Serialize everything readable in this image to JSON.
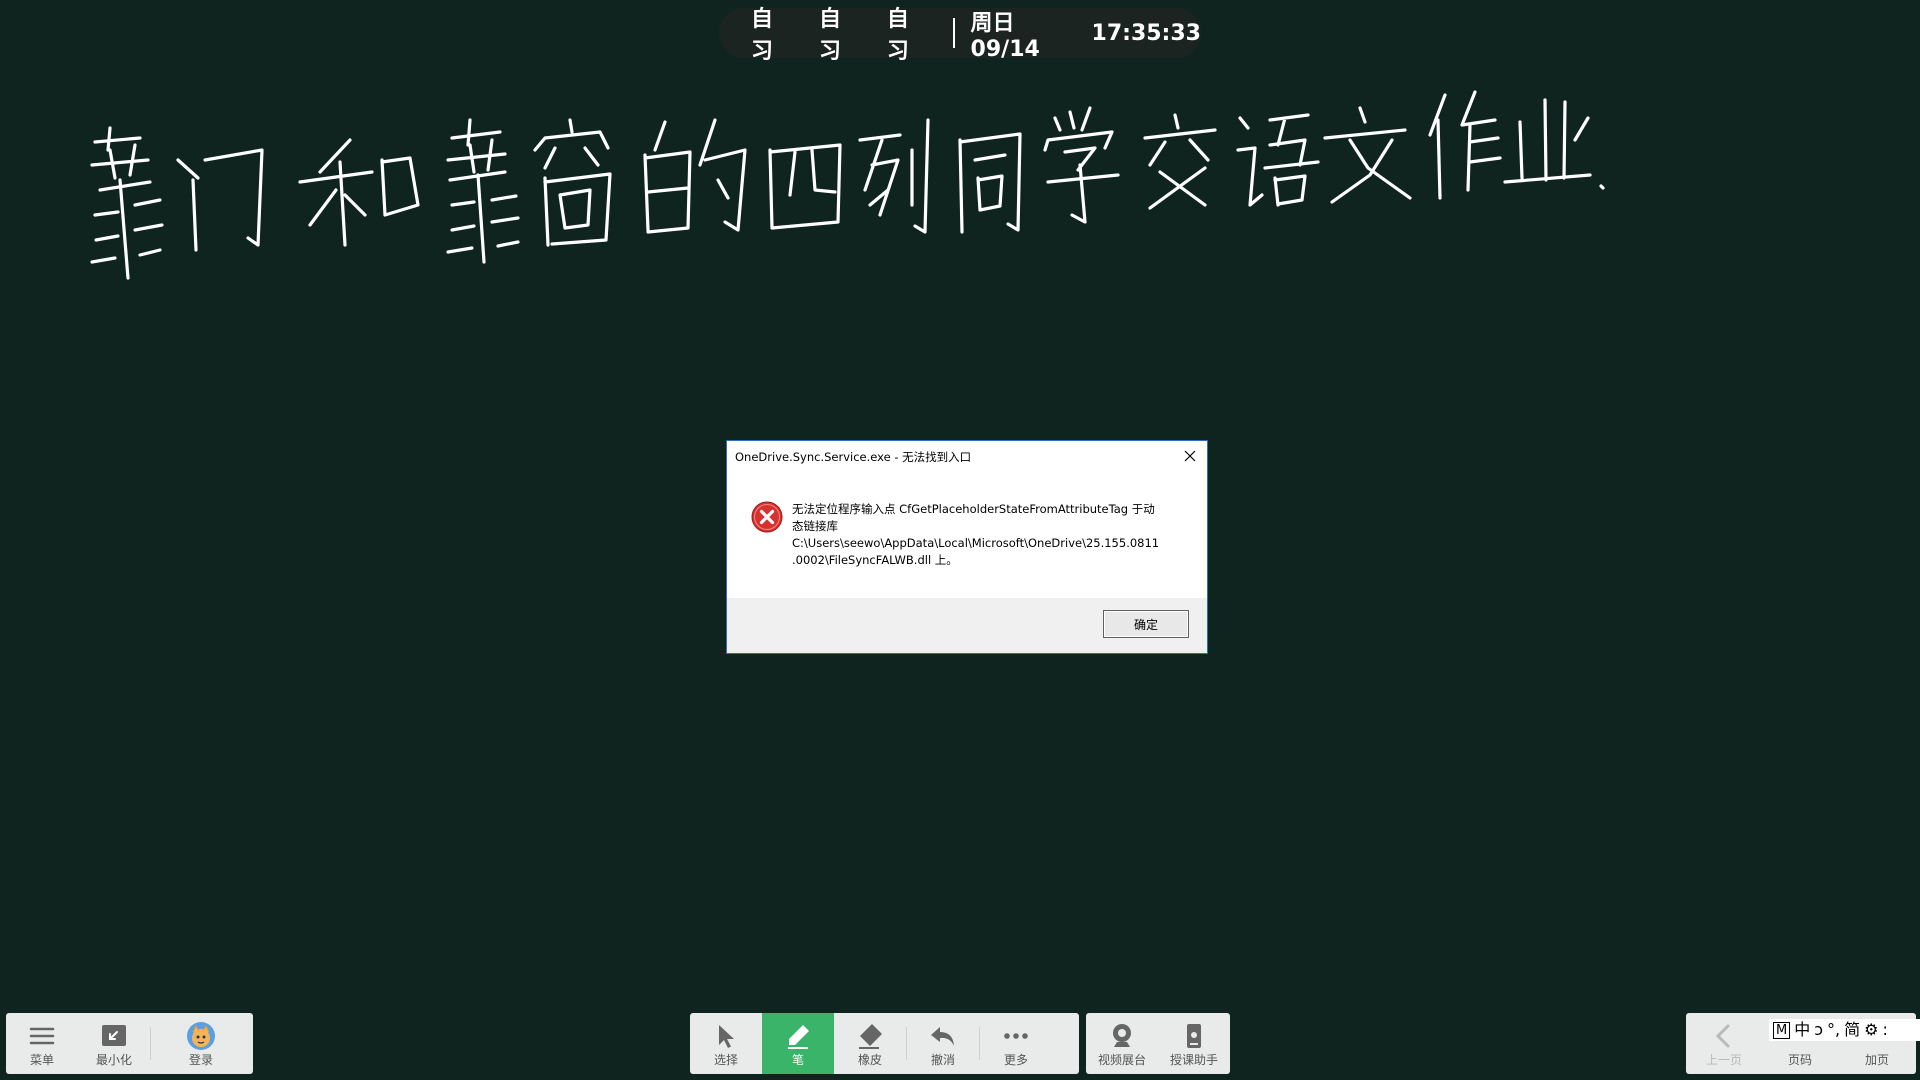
{
  "status_bar": {
    "periods": [
      "自习",
      "自习",
      "自习"
    ],
    "date": "周日 09/14",
    "time": "17:35:33"
  },
  "dialog": {
    "title": "OneDrive.Sync.Service.exe - 无法找到入口",
    "message_lines": [
      "无法定位程序输入点 CfGetPlaceholderStateFromAttributeTag 于动",
      "态链接库",
      "C:\\Users\\seewo\\AppData\\Local\\Microsoft\\OneDrive\\25.155.0811",
      ".0002\\FileSyncFALWB.dll 上。"
    ],
    "ok_label": "确定",
    "error_icon": "error-x-icon",
    "close_icon": "close-icon"
  },
  "toolbar_left": {
    "menu_label": "菜单",
    "minimize_label": "最小化",
    "login_label": "登录"
  },
  "toolbar_center": {
    "select_label": "选择",
    "pen_label": "笔",
    "eraser_label": "橡皮",
    "undo_label": "撤消",
    "more_label": "更多",
    "active_tool": "pen",
    "accent_color": "#3ab468"
  },
  "toolbar_extra": {
    "video_label": "视频展台",
    "assistant_label": "授课助手"
  },
  "toolbar_right": {
    "prev_label": "上一页",
    "page_label": "页码",
    "add_label": "加页"
  },
  "ime": {
    "items": [
      "M",
      "中",
      "ɔ",
      "°,",
      "简",
      "⚙",
      ":"
    ]
  },
  "colors": {
    "board": "#10241f",
    "ink": "#ffffff",
    "dialog_border": "#2b6fc4"
  }
}
